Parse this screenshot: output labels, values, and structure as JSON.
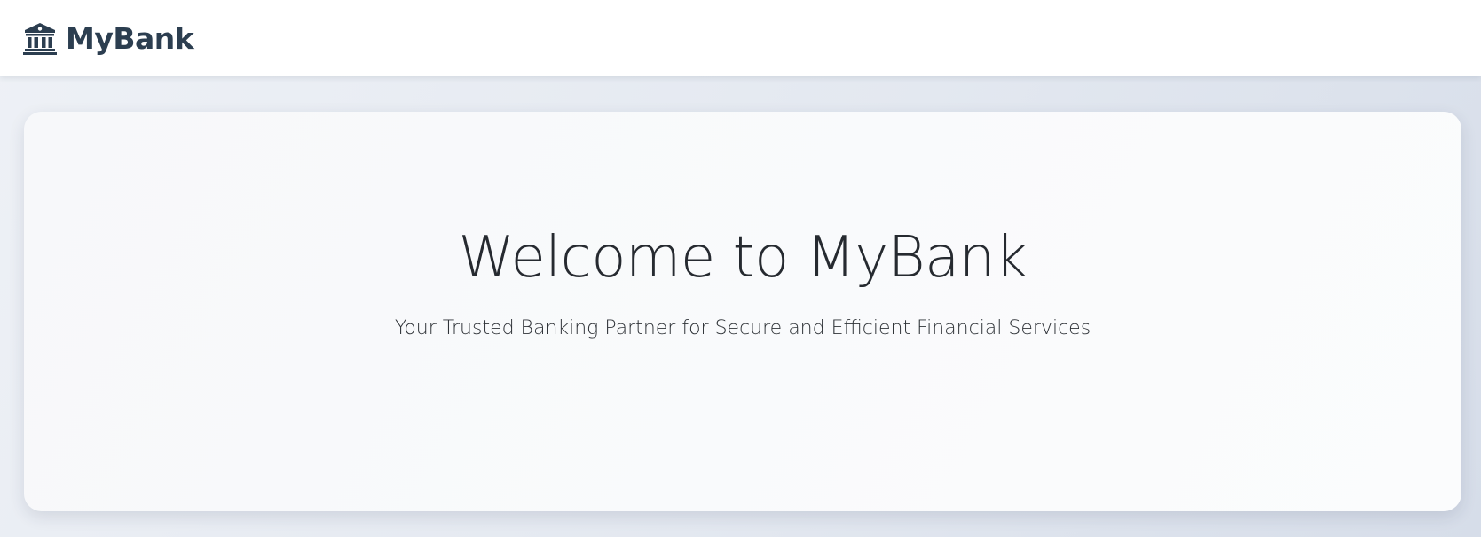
{
  "navbar": {
    "brand_icon": "bank-building-icon",
    "brand_name": "MyBank",
    "brand_color": "#2c3e50"
  },
  "hero": {
    "title": "Welcome to MyBank",
    "subtitle": "Your Trusted Banking Partner for Secure and Efficient Financial Services"
  }
}
